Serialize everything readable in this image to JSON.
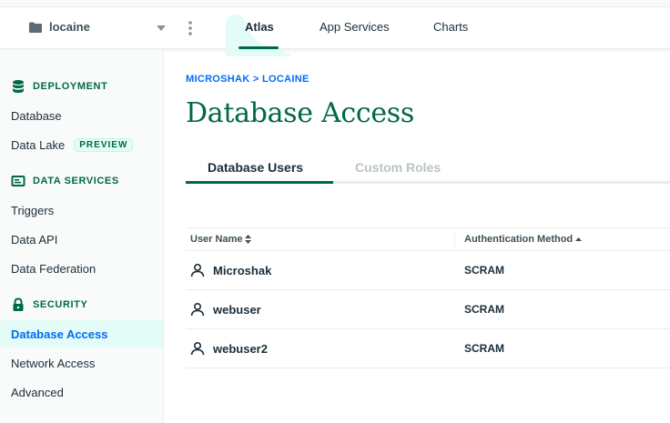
{
  "header": {
    "project_name": "locaine",
    "nav_tabs": [
      {
        "label": "Atlas",
        "active": true
      },
      {
        "label": "App Services",
        "active": false
      },
      {
        "label": "Charts",
        "active": false
      }
    ]
  },
  "sidebar": {
    "sections": [
      {
        "title": "DEPLOYMENT",
        "icon": "database-icon",
        "items": [
          {
            "label": "Database"
          },
          {
            "label": "Data Lake",
            "badge": "PREVIEW"
          }
        ]
      },
      {
        "title": "DATA SERVICES",
        "icon": "data-services-icon",
        "items": [
          {
            "label": "Triggers"
          },
          {
            "label": "Data API"
          },
          {
            "label": "Data Federation"
          }
        ]
      },
      {
        "title": "SECURITY",
        "icon": "lock-icon",
        "items": [
          {
            "label": "Database Access",
            "active": true
          },
          {
            "label": "Network Access"
          },
          {
            "label": "Advanced"
          }
        ]
      }
    ]
  },
  "breadcrumb": {
    "org": "MICROSHAK",
    "separator": ">",
    "project": "LOCAINE"
  },
  "page_title": "Database Access",
  "tabs": [
    {
      "label": "Database Users",
      "active": true
    },
    {
      "label": "Custom Roles",
      "active": false
    }
  ],
  "table": {
    "columns": [
      {
        "label": "User Name",
        "sort": "both"
      },
      {
        "label": "Authentication Method",
        "sort": "ascending"
      }
    ],
    "rows": [
      {
        "user": "Microshak",
        "auth": "SCRAM"
      },
      {
        "user": "webuser",
        "auth": "SCRAM"
      },
      {
        "user": "webuser2",
        "auth": "SCRAM"
      }
    ]
  },
  "colors": {
    "brand_green": "#00684a",
    "link_blue": "#016bf8",
    "active_bg": "#e3fcf7",
    "atlas_highlight": "#e3fcf7"
  }
}
